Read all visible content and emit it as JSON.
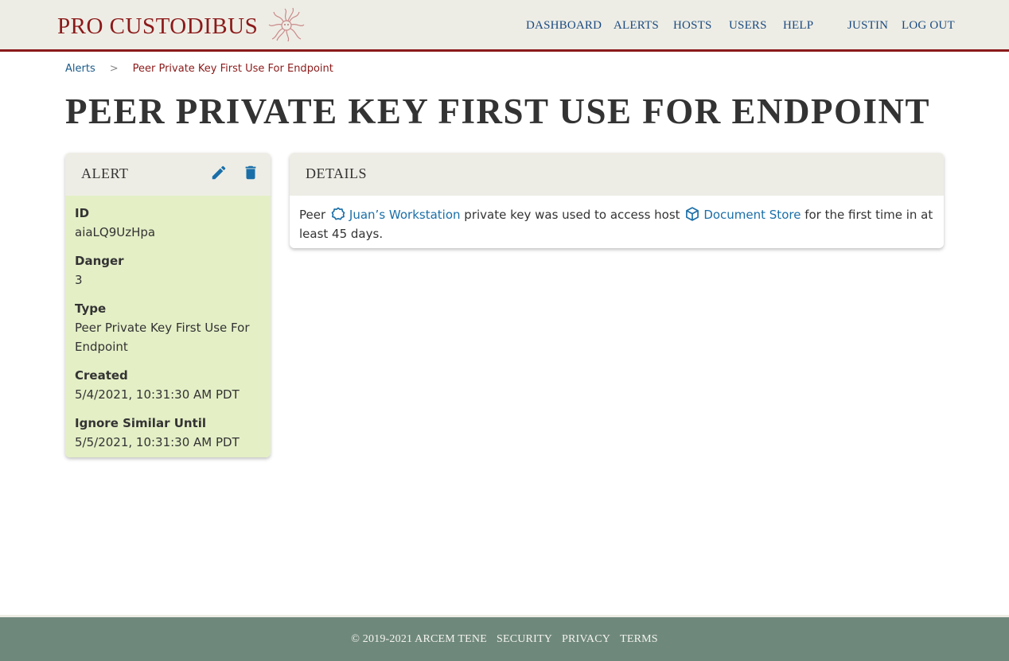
{
  "brand": {
    "name": "PRO CUSTODIBUS",
    "logo_icon": "medusa-head-icon"
  },
  "nav": {
    "items": [
      {
        "label": "DASHBOARD"
      },
      {
        "label": "ALERTS"
      },
      {
        "label": "HOSTS"
      },
      {
        "label": "USERS"
      },
      {
        "label": "HELP"
      },
      {
        "label": "JUSTIN"
      },
      {
        "label": "LOG OUT"
      }
    ]
  },
  "breadcrumb": {
    "parent": "Alerts",
    "separator": ">",
    "current": "Peer Private Key First Use For Endpoint"
  },
  "page": {
    "title": "PEER PRIVATE KEY FIRST USE FOR ENDPOINT"
  },
  "alert_card": {
    "title": "ALERT",
    "edit_icon": "pencil-icon",
    "delete_icon": "trash-icon",
    "fields": [
      {
        "label": "ID",
        "value": "aiaLQ9UzHpa"
      },
      {
        "label": "Danger",
        "value": "3"
      },
      {
        "label": "Type",
        "value": "Peer Private Key First Use For Endpoint"
      },
      {
        "label": "Created",
        "value": "5/4/2021, 10:31:30 AM PDT"
      },
      {
        "label": "Ignore Similar Until",
        "value": "5/5/2021, 10:31:30 AM PDT"
      }
    ]
  },
  "details_card": {
    "title": "DETAILS",
    "text_prefix": "Peer",
    "peer_link": "Juan’s Workstation",
    "peer_icon": "peer-endpoint-icon",
    "text_middle": "private key was used to access host",
    "host_link": "Document Store",
    "host_icon": "cube-host-icon",
    "text_suffix": "for the first time in at least 45 days."
  },
  "footer": {
    "copyright": "© 2019-2021 ARCEM TENE",
    "links": [
      {
        "label": "SECURITY"
      },
      {
        "label": "PRIVACY"
      },
      {
        "label": "TERMS"
      }
    ]
  },
  "colors": {
    "brand_red": "#8b1a1a",
    "nav_blue": "#1a4a80",
    "link_blue": "#1a6fa8",
    "header_bg": "#eeede5",
    "alert_body_bg": "#e4efc6",
    "footer_bg": "#6f887c"
  }
}
